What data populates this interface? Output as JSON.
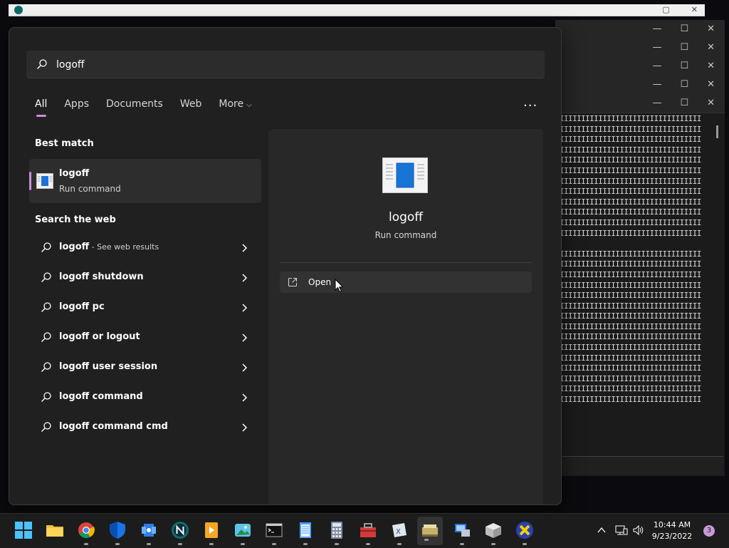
{
  "search": {
    "value": "logoff",
    "placeholder": ""
  },
  "tabs": [
    {
      "label": "All",
      "active": true
    },
    {
      "label": "Apps"
    },
    {
      "label": "Documents"
    },
    {
      "label": "Web"
    },
    {
      "label": "More"
    }
  ],
  "more_options": "...",
  "best_match": {
    "heading": "Best match",
    "title": "logoff",
    "subtitle": "Run command"
  },
  "web": {
    "heading": "Search the web",
    "items": [
      {
        "bold": "logoff",
        "suffix": " - See web results"
      },
      {
        "bold": "logoff shutdown",
        "suffix": ""
      },
      {
        "bold": "logoff pc",
        "suffix": ""
      },
      {
        "bold": "logoff or logout",
        "suffix": ""
      },
      {
        "bold": "logoff user session",
        "suffix": ""
      },
      {
        "bold": "logoff command",
        "suffix": ""
      },
      {
        "bold": "logoff command cmd",
        "suffix": ""
      }
    ]
  },
  "detail": {
    "title": "logoff",
    "subtitle": "Run command",
    "open_label": "Open"
  },
  "taskbar": {
    "time": "10:44 AM",
    "date": "9/23/2022",
    "notification_count": "3"
  },
  "terminal": {
    "line": "IIIIIIIIIIIIIIIIIIIIIIIIIIIIIIIII"
  },
  "colors": {
    "accent": "#c88fd8",
    "panel": "#202020",
    "detail_panel": "#282828"
  }
}
